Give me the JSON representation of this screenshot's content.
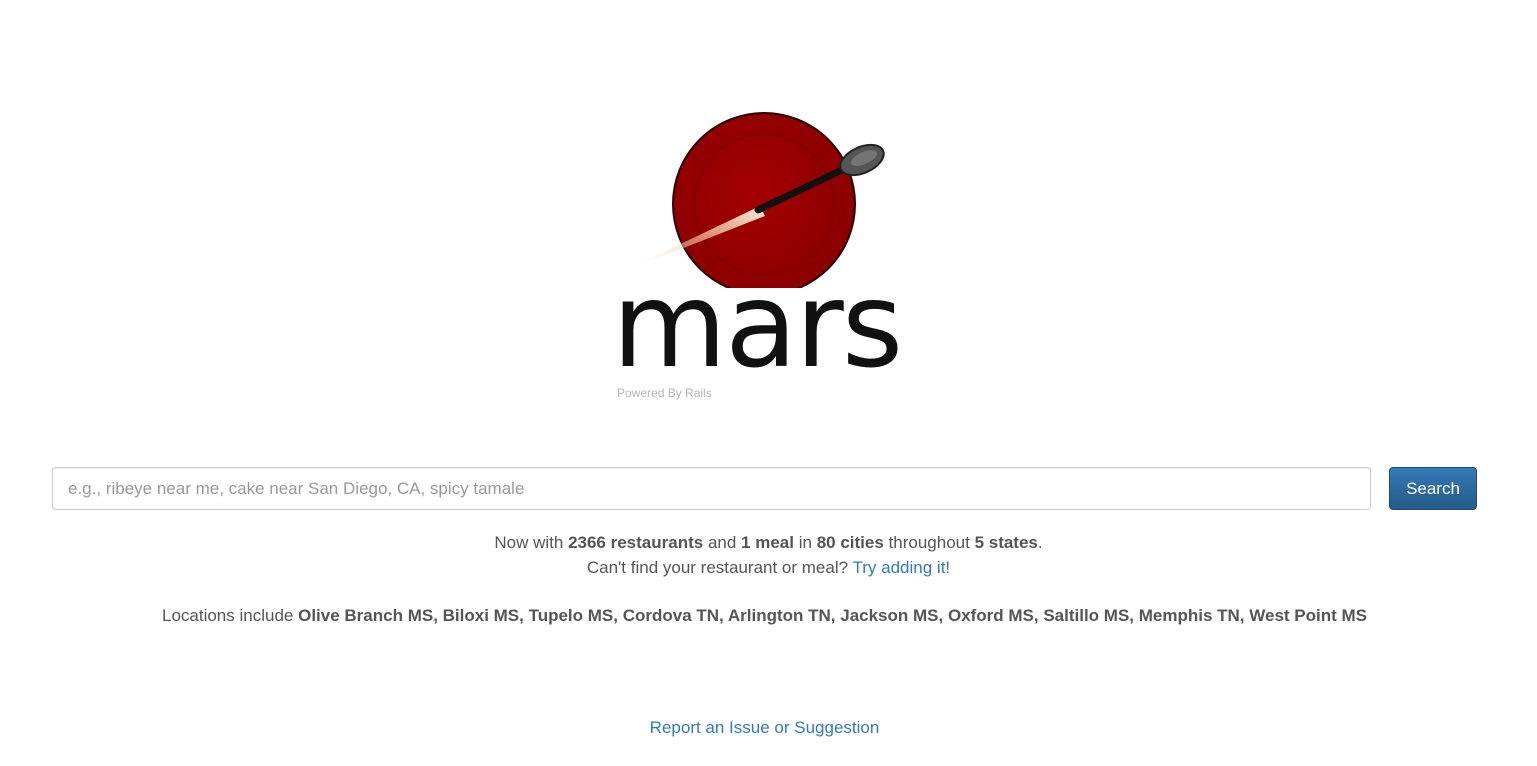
{
  "logo": {
    "name": "mars",
    "tagline": "Powered By Rails",
    "plate_color": "#990000",
    "icon": "plate-with-spoon-icon"
  },
  "search": {
    "placeholder": "e.g., ribeye near me, cake near San Diego, CA, spicy tamale",
    "value": "",
    "button_label": "Search",
    "button_color": "#337ab7"
  },
  "stats": {
    "prefix": "Now with",
    "restaurants": "2366 restaurants",
    "and": "and",
    "meals": "1 meal",
    "in": "in",
    "cities": "80 cities",
    "throughout": "throughout",
    "states": "5 states",
    "period": ".",
    "missing_text": "Can't find your restaurant or meal?",
    "add_link": "Try adding it!"
  },
  "locations": {
    "prefix": "Locations include",
    "list": "Olive Branch MS, Biloxi MS, Tupelo MS, Cordova TN, Arlington TN, Jackson MS, Oxford MS, Saltillo MS, Memphis TN, West Point MS"
  },
  "footer": {
    "report_link": "Report an Issue or Suggestion",
    "link_color": "#337ab7"
  }
}
